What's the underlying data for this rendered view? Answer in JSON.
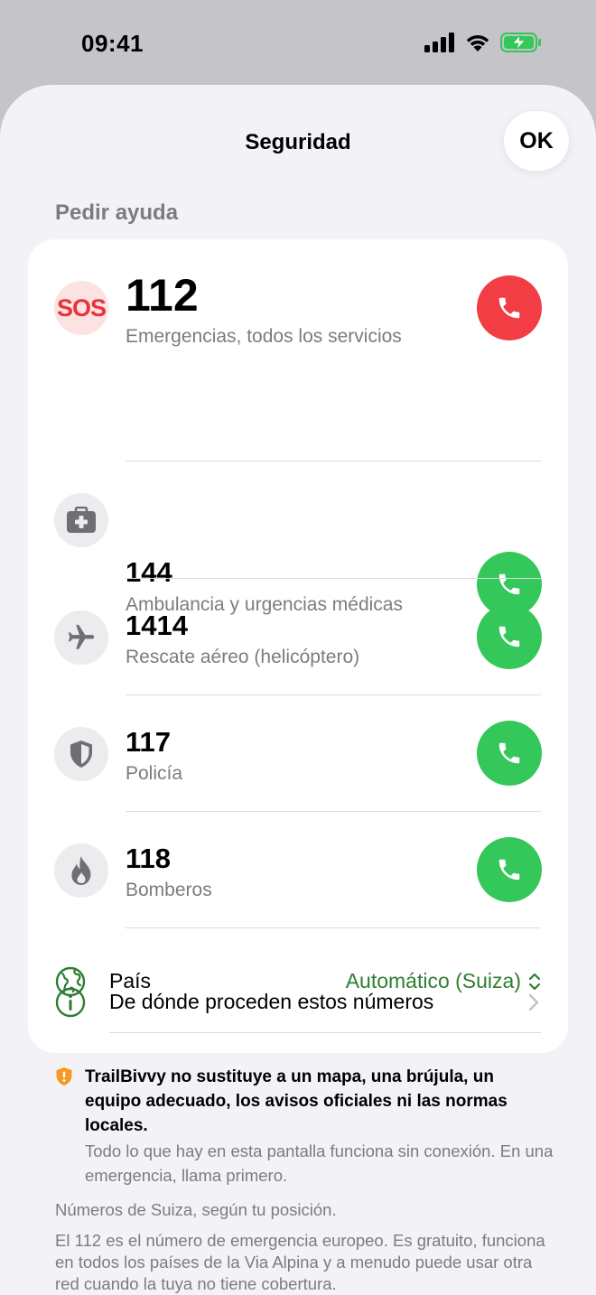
{
  "status_bar": {
    "time": "09:41"
  },
  "sheet": {
    "title": "Seguridad",
    "ok_label": "OK"
  },
  "section": {
    "header": "Pedir ayuda"
  },
  "services": [
    {
      "icon": "sos-icon",
      "badge": "SOS",
      "number": "112",
      "description": "Emergencias, todos los servicios",
      "call": "red"
    },
    {
      "icon": "first-aid-kit-icon",
      "number": "144",
      "description": "Ambulancia y urgencias médicas",
      "call": "green"
    },
    {
      "icon": "airplane-icon",
      "number": "1414",
      "description": "Rescate aéreo (helicóptero)",
      "call": "green"
    },
    {
      "icon": "shield-icon",
      "number": "117",
      "description": "Policía",
      "call": "green"
    },
    {
      "icon": "flame-icon",
      "number": "118",
      "description": "Bomberos",
      "call": "green"
    }
  ],
  "country": {
    "label": "País",
    "value": "Automático (Suiza)"
  },
  "source": {
    "label": "De dónde proceden estos números"
  },
  "notice": {
    "bold": "TrailBivvy no sustituye a un mapa, una brújula, un equipo adecuado, los avisos oficiales ni las normas locales.",
    "sub": "Todo lo que hay en esta pantalla funciona sin conexión. En una emergencia, llama primero."
  },
  "footer": {
    "line1": "Números de Suiza, según tu posición.",
    "line2": "El 112 es el número de emergencia europeo. Es gratuito, funciona en todos los países de la Via Alpina y a menudo puede usar otra red cuando la tuya no tiene cobertura."
  },
  "colors": {
    "accent_green": "#34c759",
    "emergency_red": "#f23d44",
    "country_value": "#2e7d32",
    "notice_shield": "#f59a23"
  }
}
